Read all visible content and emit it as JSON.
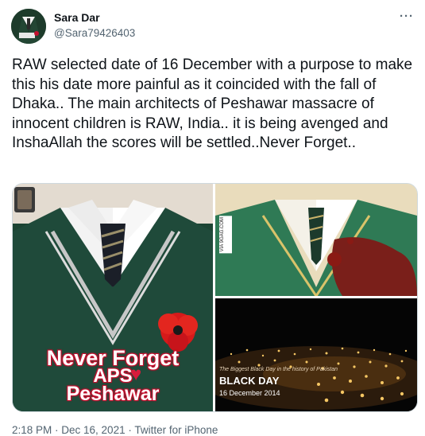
{
  "tweet": {
    "author_name": "Sara Dar",
    "author_handle": "@Sara79426403",
    "more_label": "···",
    "text": "RAW selected date of  16 December with a purpose to make this his date more painful as it coincided with the fall of Dhaka.. The main architects of Peshawar massacre of innocent children is RAW, India.. it is being avenged and InshaAllah the scores will be settled..Never Forget..",
    "footer": "2:18 PM · Dec 16, 2021 · Twitter for iPhone"
  },
  "media": {
    "image1": {
      "line1": "Never Forget",
      "line2": "APS",
      "line3": "Peshawar"
    },
    "image2": {
      "watermark": "VIA 9GAG.COM"
    },
    "image3": {
      "caption": "The Biggest Black Day in the history of Pakistan",
      "title": "BLACK DAY",
      "date": "16 December 2014"
    }
  },
  "colors": {
    "accent_red": "#c4102e",
    "blazer_green": "#1f4a3a",
    "muted_text": "#536471"
  },
  "icons": {
    "avatar": "uniform-avatar",
    "more": "more-dots-icon",
    "poppy": "poppy-flower",
    "heart": "broken-heart-icon"
  }
}
